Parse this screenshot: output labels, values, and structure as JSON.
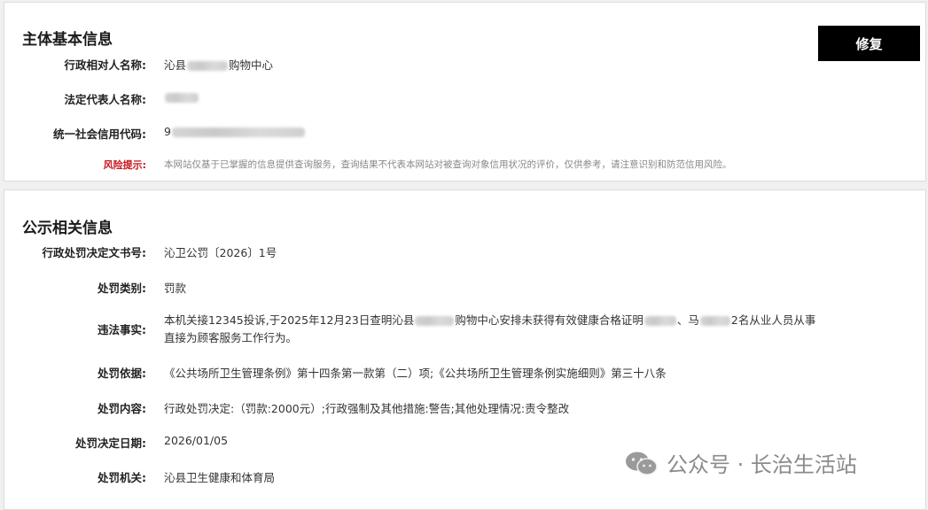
{
  "basic": {
    "title": "主体基本信息",
    "repair_button": "修复",
    "fields": {
      "admin_party_label": "行政相对人名称:",
      "admin_party_prefix": "沁县",
      "admin_party_suffix": "购物中心",
      "legal_rep_label": "法定代表人名称:",
      "legal_rep_first": "",
      "credit_code_label": "统一社会信用代码:",
      "credit_code_first": "9",
      "risk_label": "风险提示:",
      "risk_text": "本网站仅基于已掌握的信息提供查询服务，查询结果不代表本网站对被查询对象信用状况的评价，仅供参考，请注意识别和防范信用风险。"
    }
  },
  "public": {
    "title": "公示相关信息",
    "doc_no_label": "行政处罚决定文书号:",
    "doc_no": "沁卫公罚〔2026〕1号",
    "category_label": "处罚类别:",
    "category": "罚款",
    "facts_label": "违法事实:",
    "facts_part1": "本机关接12345投诉,于2025年12月23日查明沁县",
    "facts_part2": "购物中心安排未获得有效健康合格证明",
    "facts_part3": "、马",
    "facts_part4": "2名从业人员从事",
    "facts_line2": "直接为顾客服务工作行为。",
    "basis_label": "处罚依据:",
    "basis": "《公共场所卫生管理条例》第十四条第一款第（二）项;《公共场所卫生管理条例实施细则》第三十八条",
    "content_label": "处罚内容:",
    "content": "行政处罚决定:（罚款:2000元）;行政强制及其他措施:警告;其他处理情况:责令整改",
    "date_label": "处罚决定日期:",
    "date": "2026/01/05",
    "authority_label": "处罚机关:",
    "authority": "沁县卫生健康和体育局"
  },
  "watermark": {
    "icon": "wechat-icon",
    "text": "公众号 · 长治生活站"
  }
}
